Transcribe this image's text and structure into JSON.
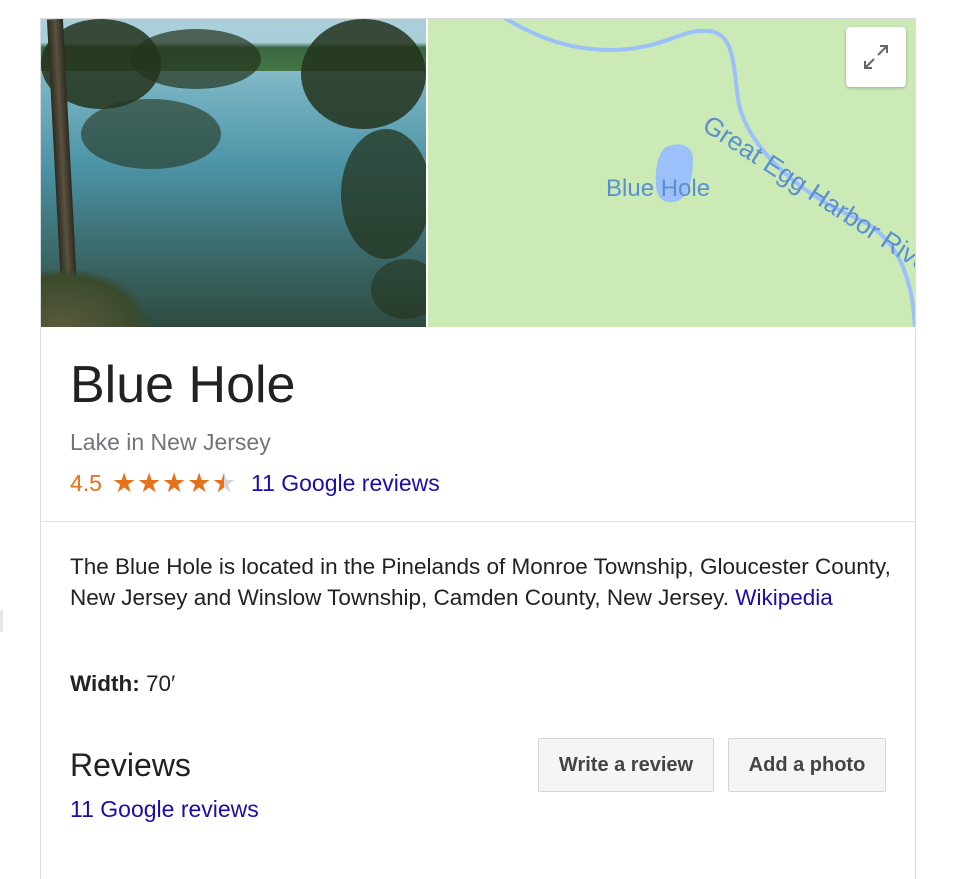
{
  "place": {
    "title": "Blue Hole",
    "subtitle": "Lake in New Jersey",
    "rating": "4.5",
    "rating_value": 4.5,
    "rating_max": 5,
    "reviews_link": "11 Google reviews"
  },
  "map": {
    "lake_label": "Blue Hole",
    "river_label": "Great Egg Harbor Rive",
    "expand_icon": "expand-arrows-icon"
  },
  "description": {
    "text": "The Blue Hole is located in the Pinelands of Monroe Township, Gloucester County, New Jersey and Winslow Township, Camden County, New Jersey.",
    "source_link": "Wikipedia"
  },
  "facts": {
    "width_label": "Width:",
    "width_value": "70′"
  },
  "reviews": {
    "heading": "Reviews",
    "link": "11 Google reviews",
    "write_button": "Write a review",
    "photo_button": "Add a photo"
  },
  "colors": {
    "rating": "#e7711b",
    "link": "#1a0dab",
    "map_land": "#cbeab6",
    "map_water": "#9cc0f9",
    "map_text": "#5b8fd0"
  }
}
